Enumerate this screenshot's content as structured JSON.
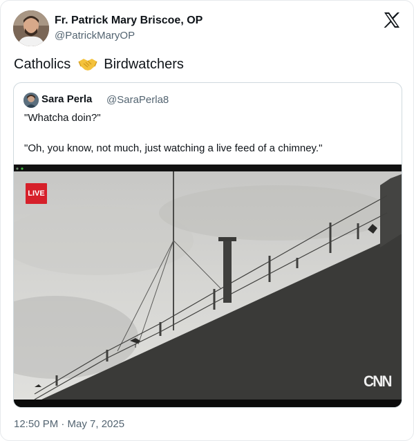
{
  "author": {
    "name": "Fr. Patrick Mary Briscoe, OP",
    "handle": "@PatrickMaryOP"
  },
  "tweet": {
    "text_before": "Catholics",
    "emoji": "handshake-icon",
    "text_after": "Birdwatchers",
    "timestamp": "12:50 PM · May 7, 2025"
  },
  "quoted": {
    "name": "Sara Perla",
    "handle": "@SaraPerla8",
    "line1": "\"Whatcha doin?\"",
    "line2": "\"Oh, you know, not much, just watching a live feed of a chimney.\""
  },
  "media": {
    "live_badge": "LIVE",
    "watermark": "CNN"
  },
  "colors": {
    "live_red": "#d6202a",
    "secondary_text": "#536471",
    "emoji_yellow": "#f4c23c"
  }
}
